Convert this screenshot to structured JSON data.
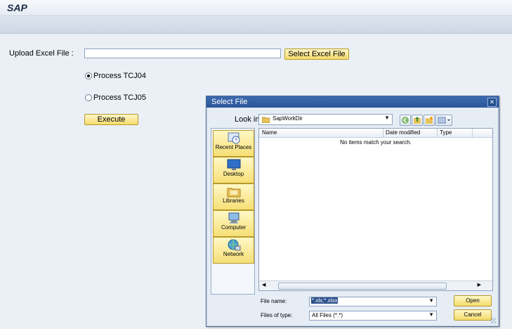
{
  "app": {
    "title": "SAP"
  },
  "form": {
    "upload_label": "Upload Excel File :",
    "upload_value": "",
    "select_button": "Select Excel File",
    "radio1": {
      "label": "Process TCJ04",
      "checked": true
    },
    "radio2": {
      "label": "Process TCJ05",
      "checked": false
    },
    "execute_button": "Execute"
  },
  "dialog": {
    "title": "Select File",
    "close_label": "✕",
    "look_in_label": "Look in:",
    "look_in_value": "SapWorkDir",
    "places": [
      {
        "label": "Recent Places",
        "icon": "recent-places-icon"
      },
      {
        "label": "Desktop",
        "icon": "desktop-icon"
      },
      {
        "label": "Libraries",
        "icon": "libraries-icon"
      },
      {
        "label": "Computer",
        "icon": "computer-icon"
      },
      {
        "label": "Network",
        "icon": "network-icon"
      }
    ],
    "columns": [
      "Name",
      "Date modified",
      "Type"
    ],
    "empty_message": "No items match your search.",
    "file_name_label": "File name:",
    "file_name_value": "*.xls;*.xlsx",
    "files_of_type_label": "Files of type:",
    "files_of_type_value": "All Files (*.*)",
    "open_button": "Open",
    "cancel_button": "Cancel"
  }
}
